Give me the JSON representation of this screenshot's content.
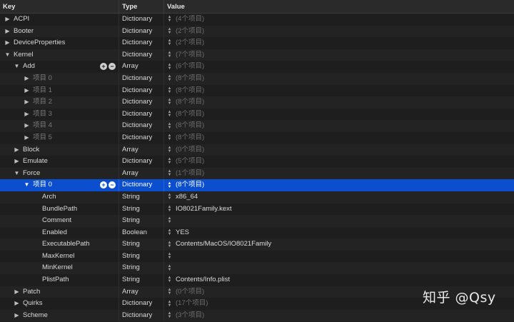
{
  "header": {
    "key": "Key",
    "type": "Type",
    "value": "Value"
  },
  "rows": [
    {
      "key": "ACPI",
      "level": 0,
      "tri": "right",
      "type": "Dictionary",
      "value": "(4个项目)",
      "value_style": "dim"
    },
    {
      "key": "Booter",
      "level": 0,
      "tri": "right",
      "type": "Dictionary",
      "value": "(2个项目)",
      "value_style": "dim"
    },
    {
      "key": "DeviceProperties",
      "level": 0,
      "tri": "right",
      "type": "Dictionary",
      "value": "(2个项目)",
      "value_style": "dim"
    },
    {
      "key": "Kernel",
      "level": 0,
      "tri": "down",
      "type": "Dictionary",
      "value": "(7个项目)",
      "value_style": "dim"
    },
    {
      "key": "Add",
      "level": 1,
      "tri": "down",
      "type": "Array",
      "value": "(6个项目)",
      "value_style": "dim",
      "pm": true
    },
    {
      "key": "项目 0",
      "level": 2,
      "tri": "right",
      "type": "Dictionary",
      "value": "(8个项目)",
      "value_style": "dim",
      "key_dim": true
    },
    {
      "key": "项目 1",
      "level": 2,
      "tri": "right",
      "type": "Dictionary",
      "value": "(8个项目)",
      "value_style": "dim",
      "key_dim": true
    },
    {
      "key": "项目 2",
      "level": 2,
      "tri": "right",
      "type": "Dictionary",
      "value": "(8个项目)",
      "value_style": "dim",
      "key_dim": true
    },
    {
      "key": "项目 3",
      "level": 2,
      "tri": "right",
      "type": "Dictionary",
      "value": "(8个项目)",
      "value_style": "dim",
      "key_dim": true
    },
    {
      "key": "项目 4",
      "level": 2,
      "tri": "right",
      "type": "Dictionary",
      "value": "(8个项目)",
      "value_style": "dim",
      "key_dim": true
    },
    {
      "key": "项目 5",
      "level": 2,
      "tri": "right",
      "type": "Dictionary",
      "value": "(8个项目)",
      "value_style": "dim",
      "key_dim": true
    },
    {
      "key": "Block",
      "level": 1,
      "tri": "right",
      "type": "Array",
      "value": "(0个项目)",
      "value_style": "dim"
    },
    {
      "key": "Emulate",
      "level": 1,
      "tri": "right",
      "type": "Dictionary",
      "value": "(5个项目)",
      "value_style": "dim"
    },
    {
      "key": "Force",
      "level": 1,
      "tri": "down",
      "type": "Array",
      "value": "(1个项目)",
      "value_style": "dim"
    },
    {
      "key": "项目 0",
      "level": 2,
      "tri": "down",
      "type": "Dictionary",
      "value": "(8个项目)",
      "value_style": "dim",
      "selected": true,
      "pm": true
    },
    {
      "key": "Arch",
      "level": 3,
      "tri": "",
      "type": "String",
      "value": "x86_64",
      "value_style": "str"
    },
    {
      "key": "BundlePath",
      "level": 3,
      "tri": "",
      "type": "String",
      "value": "IO8021Family.kext",
      "value_style": "str"
    },
    {
      "key": "Comment",
      "level": 3,
      "tri": "",
      "type": "String",
      "value": "",
      "value_style": "str"
    },
    {
      "key": "Enabled",
      "level": 3,
      "tri": "",
      "type": "Boolean",
      "value": "YES",
      "value_style": "str"
    },
    {
      "key": "ExecutablePath",
      "level": 3,
      "tri": "",
      "type": "String",
      "value": "Contents/MacOS/IO8021Family",
      "value_style": "str"
    },
    {
      "key": "MaxKernel",
      "level": 3,
      "tri": "",
      "type": "String",
      "value": "",
      "value_style": "str"
    },
    {
      "key": "MinKernel",
      "level": 3,
      "tri": "",
      "type": "String",
      "value": "",
      "value_style": "str"
    },
    {
      "key": "PlistPath",
      "level": 3,
      "tri": "",
      "type": "String",
      "value": "Contents/Info.plist",
      "value_style": "str"
    },
    {
      "key": "Patch",
      "level": 1,
      "tri": "right",
      "type": "Array",
      "value": "(0个项目)",
      "value_style": "dim"
    },
    {
      "key": "Quirks",
      "level": 1,
      "tri": "right",
      "type": "Dictionary",
      "value": "(17个项目)",
      "value_style": "dim"
    },
    {
      "key": "Scheme",
      "level": 1,
      "tri": "right",
      "type": "Dictionary",
      "value": "(3个项目)",
      "value_style": "dim"
    }
  ],
  "icons": {
    "collapsed": "triangle-right-icon",
    "expanded": "triangle-down-icon",
    "stepper": "up-down-stepper-icon",
    "add": "plus-icon",
    "remove": "minus-icon"
  },
  "colors": {
    "selection": "#0b4fcf",
    "background": "#1e1e1e",
    "alt_row": "#232323"
  },
  "watermark": "知乎 @Qsy"
}
